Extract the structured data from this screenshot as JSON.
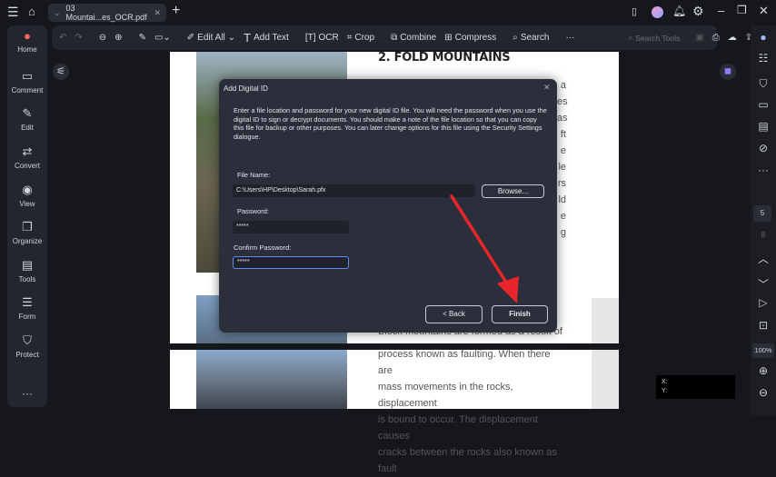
{
  "app": {
    "tab_title": "03 Mountai...es_OCR.pdf"
  },
  "toolbar": {
    "edit_all": "Edit All",
    "add_text": "Add Text",
    "ocr": "OCR",
    "crop": "Crop",
    "combine": "Combine",
    "compress": "Compress",
    "search": "Search",
    "more": "···",
    "search_tools_placeholder": "Search Tools"
  },
  "sidebar": {
    "items": [
      {
        "label": "Home",
        "icon": "rocket-icon"
      },
      {
        "label": "Comment",
        "icon": "comment-icon"
      },
      {
        "label": "Edit",
        "icon": "edit-icon"
      },
      {
        "label": "Convert",
        "icon": "convert-icon"
      },
      {
        "label": "View",
        "icon": "eye-icon"
      },
      {
        "label": "Organize",
        "icon": "organize-icon"
      },
      {
        "label": "Tools",
        "icon": "toolbox-icon"
      },
      {
        "label": "Form",
        "icon": "form-icon"
      },
      {
        "label": "Protect",
        "icon": "shield-icon"
      }
    ],
    "more": "···"
  },
  "right_panel": {
    "current_page": "5",
    "total_pages": "8",
    "zoom": "100%"
  },
  "document": {
    "heading": "2. FOLD MOUNTAINS",
    "fragments": [
      "a",
      "es",
      "as",
      "ft",
      "e",
      "le",
      "rs",
      "ld",
      "e",
      "g"
    ],
    "partial_line": "Block mountains are formed as a result of a",
    "lines": [
      "process known as faulting. When there are",
      "mass movements in the rocks, displacement",
      "is bound to occur. The displacement causes",
      "cracks between the rocks also known as fault"
    ]
  },
  "dialog": {
    "title": "Add Digital ID",
    "description": "Enter a file location and password for your new digital ID file. You will need the password when you use the digital ID to sign or decrypt documents. You should make a note of the file location so that you can copy this file for backup or other purposes. You can later change options for this file using the Security Settings dialogue.",
    "file_name_label": "File Name:",
    "file_name_value": "C:\\Users\\HP\\Desktop\\Sarah.pfx",
    "browse": "Browse...",
    "password_label": "Password:",
    "password_value": "*****",
    "confirm_label": "Confirm Password:",
    "confirm_value": "*****",
    "back": "< Back",
    "finish": "Finish"
  },
  "coords": {
    "x_label": "X:",
    "y_label": "Y:"
  },
  "colors": {
    "accent_arrow": "#e8262a",
    "dialog_bg": "#2b2f3b",
    "focus": "#5b8def"
  }
}
